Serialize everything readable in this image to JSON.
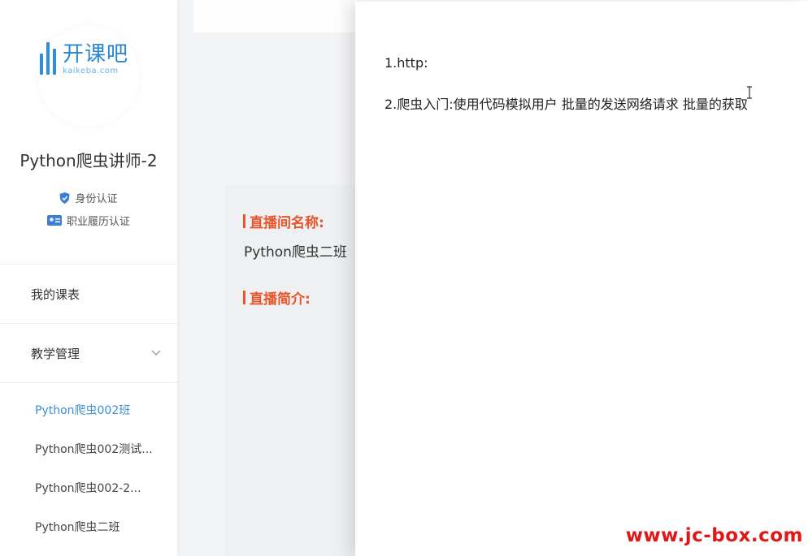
{
  "sidebar": {
    "logo": {
      "cn": "开课吧",
      "en": "kaikeba.com"
    },
    "teacher_name": "Python爬虫讲师-2",
    "certifications": [
      {
        "label": "身份认证",
        "icon": "shield-icon"
      },
      {
        "label": "职业履历认证",
        "icon": "id-card-icon"
      }
    ],
    "menu": [
      {
        "label": "我的课表"
      },
      {
        "label": "教学管理",
        "icon": "chevron-down-icon"
      }
    ],
    "sub_items": [
      {
        "label": "Python爬虫002班",
        "active": true
      },
      {
        "label": "Python爬虫002测试..."
      },
      {
        "label": "Python爬虫002-2..."
      },
      {
        "label": "Python爬虫二班"
      }
    ]
  },
  "content": {
    "live_name_label": "直播间名称:",
    "live_name_value": "Python爬虫二班",
    "live_intro_label": "直播简介:"
  },
  "panel": {
    "lines": [
      "1.http:",
      "2.爬虫入门:使用代码模拟用户 批量的发送网络请求 批量的获取"
    ]
  },
  "watermark": "www.jc-box.com",
  "colors": {
    "accent_blue": "#3b8fd9",
    "label_orange": "#e8552b",
    "watermark_red": "#e21616"
  }
}
